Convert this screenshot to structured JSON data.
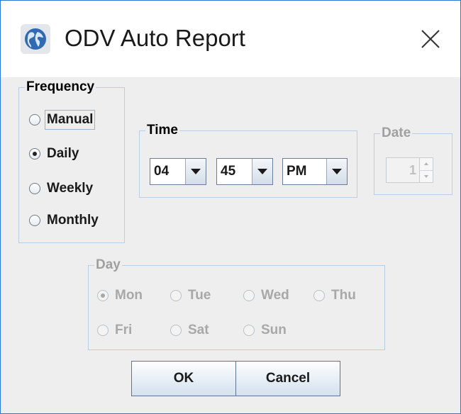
{
  "window": {
    "title": "ODV Auto Report"
  },
  "frequency": {
    "legend": "Frequency",
    "options": [
      {
        "label": "Manual",
        "selected": false
      },
      {
        "label": "Daily",
        "selected": true
      },
      {
        "label": "Weekly",
        "selected": false
      },
      {
        "label": "Monthly",
        "selected": false
      }
    ]
  },
  "time": {
    "legend": "Time",
    "hour": "04",
    "minute": "45",
    "ampm": "PM"
  },
  "date": {
    "legend": "Date",
    "value": "1",
    "enabled": false
  },
  "day": {
    "legend": "Day",
    "enabled": false,
    "options": [
      {
        "label": "Mon",
        "selected": true
      },
      {
        "label": "Tue",
        "selected": false
      },
      {
        "label": "Wed",
        "selected": false
      },
      {
        "label": "Thu",
        "selected": false
      },
      {
        "label": "Fri",
        "selected": false
      },
      {
        "label": "Sat",
        "selected": false
      },
      {
        "label": "Sun",
        "selected": false
      }
    ]
  },
  "buttons": {
    "ok": "OK",
    "cancel": "Cancel"
  },
  "icons": {
    "app": "globe-icon",
    "close": "close-icon",
    "dropdown": "chevron-down-icon"
  },
  "colors": {
    "border_accent": "#2b79d8",
    "group_border": "#b9cfe6",
    "disabled_text": "#a8a8a8"
  }
}
